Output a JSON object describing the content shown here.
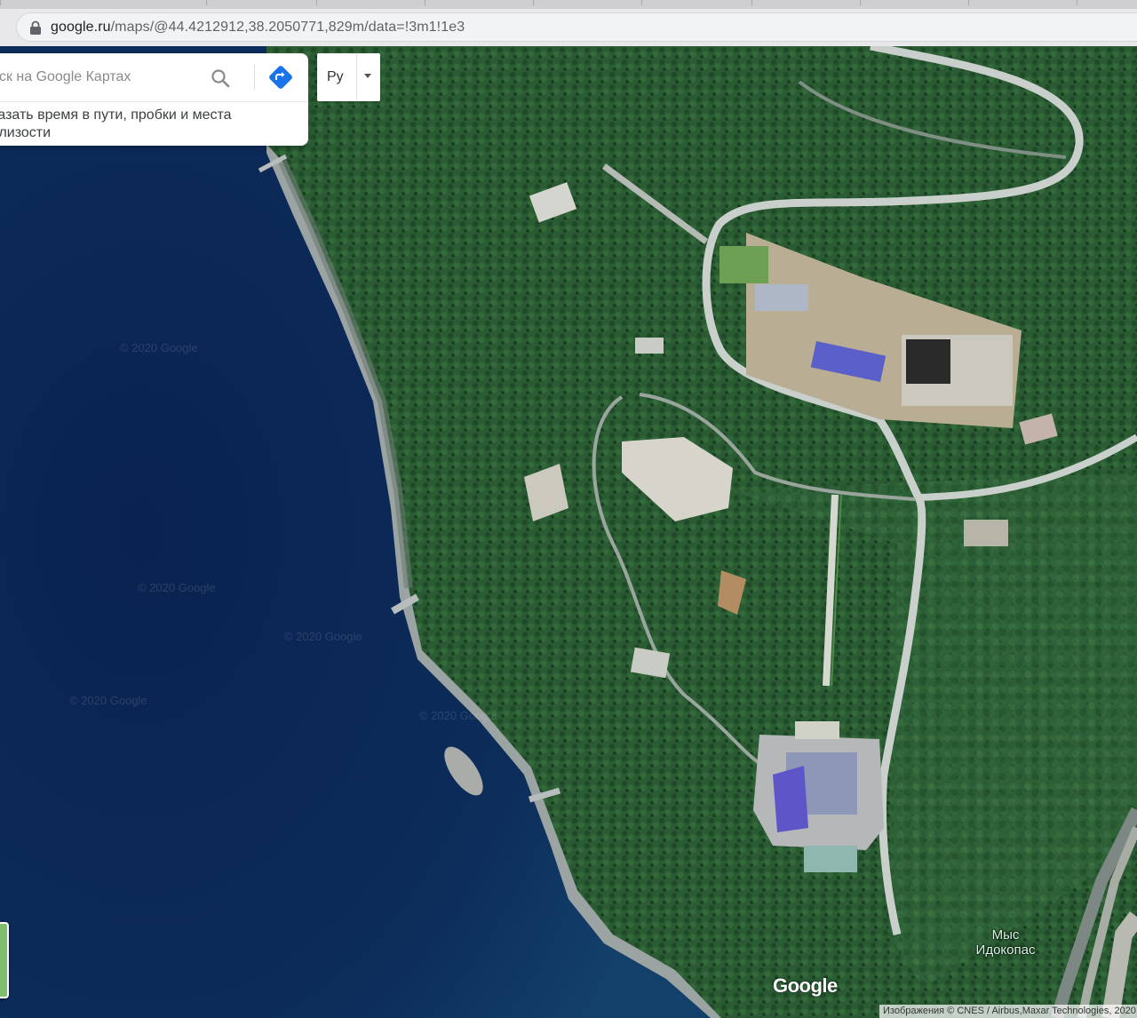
{
  "browser": {
    "url_host": "google.ru",
    "url_path": "/maps/@44.4212912,38.2050771,829m/data=!3m1!1e3"
  },
  "search": {
    "placeholder": "иск на Google Картах",
    "hint_line1": "казать время в пути, пробки и места",
    "hint_line2": "близости"
  },
  "keyboard": {
    "label": "Ру"
  },
  "map": {
    "cape_label_line1": "Мыс",
    "cape_label_line2": "Идокопас",
    "logo": "Google",
    "attribution": "Изображения © CNES / Airbus,Maxar Technologies, 2020",
    "watermarks": [
      "© 2020 Google",
      "© 2020 Google",
      "© 2020 Google",
      "© 2020 Google",
      "© 2020 Google"
    ]
  },
  "colors": {
    "sea": "#0b2452",
    "forest": "#25542f",
    "beach": "#9aa1a0",
    "road": "#c9cfca",
    "roof_blue": "#5a5fc9",
    "construction": "#c8b89a"
  }
}
